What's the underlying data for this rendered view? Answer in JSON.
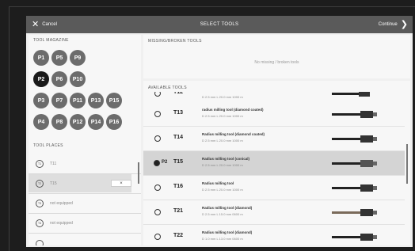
{
  "topbar": {
    "cancel_label": "Cancel",
    "title": "SELECT TOOLS",
    "continue_label": "Continue"
  },
  "magazine": {
    "label": "TOOL MAGAZINE",
    "slots": [
      "P1",
      "P5",
      "P9",
      "P2",
      "P6",
      "P10",
      "P3",
      "P7",
      "P11",
      "P13",
      "P15",
      "P4",
      "P8",
      "P12",
      "P14",
      "P16"
    ],
    "selected": "P2"
  },
  "tool_places": {
    "label": "TOOL PLACES",
    "items": [
      {
        "icon": "T1",
        "label": "T11",
        "selected": false
      },
      {
        "icon": "T2",
        "label": "T15",
        "selected": true,
        "action": "×"
      },
      {
        "icon": "T3",
        "label": "not equipped",
        "selected": false
      },
      {
        "icon": "T4",
        "label": "not equipped",
        "selected": false
      }
    ]
  },
  "missing": {
    "label": "MISSING/BROKEN TOOLS",
    "empty_text": "No missing / broken tools"
  },
  "available": {
    "label": "AVAILABLE TOOLS",
    "tools": [
      {
        "id": "T13",
        "name": "radius milling tool (diamond coated)",
        "dims": "D 2.5 mm L 20.0 mm 1000 m",
        "selected": false,
        "place": ""
      },
      {
        "id": "T14",
        "name": "Radius milling tool (diamond coated)",
        "dims": "D 2.5 mm L 20.0 mm 1000 m",
        "selected": false,
        "place": ""
      },
      {
        "id": "T15",
        "name": "Radius milling tool (conical)",
        "dims": "D 2.5 mm L 20.0 mm 1000 m",
        "selected": true,
        "place": "P2"
      },
      {
        "id": "T16",
        "name": "Radius milling tool",
        "dims": "D 2.5 mm L 20.0 mm 1000 m",
        "selected": false,
        "place": ""
      },
      {
        "id": "T21",
        "name": "Radius milling tool (diamond)",
        "dims": "D 2.5 mm L 15.0 mm 0600 m",
        "selected": false,
        "place": ""
      },
      {
        "id": "T22",
        "name": "Radius milling tool (diamond)",
        "dims": "D 1.0 mm L 13.0 mm 0600 m",
        "selected": false,
        "place": ""
      }
    ]
  },
  "icons": {
    "cancel": "close-icon",
    "continue": "chevron-right-icon",
    "tool_image": "milling-tool-icon"
  },
  "colors": {
    "topbar": "#5a5a5a",
    "slot": "#6c6c6c",
    "slot_selected": "#1a1a1a",
    "row_selected": "#d4d4d4"
  }
}
